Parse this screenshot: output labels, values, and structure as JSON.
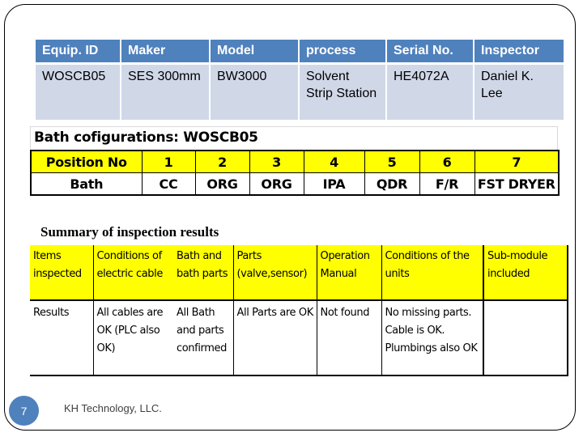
{
  "equipment": {
    "headers": [
      "Equip. ID",
      "Maker",
      "Model",
      "process",
      "Serial No.",
      "Inspector"
    ],
    "values": [
      "WOSCB05",
      "SES 300mm",
      "BW3000",
      "Solvent Strip Station",
      "HE4072A",
      "Daniel K. Lee"
    ]
  },
  "bath_config": {
    "title": "Bath cofigurations: WOSCB05",
    "position_label": "Position No",
    "positions": [
      "1",
      "2",
      "3",
      "4",
      "5",
      "6",
      "7"
    ],
    "bath_label": "Bath",
    "baths": [
      "CC",
      "ORG",
      "ORG",
      "IPA",
      "QDR",
      "F/R",
      "FST DRYER"
    ]
  },
  "summary": {
    "title": "Summary of inspection results",
    "header_row": [
      "Items inspected",
      "Conditions of electric cable",
      "Bath and bath parts",
      "Parts (valve,sensor)",
      "Operation Manual",
      "Conditions of the units",
      "Sub-module included"
    ],
    "result_row": [
      "Results",
      "All cables are OK (PLC also OK)",
      "All Bath and parts confirmed",
      "All Parts are OK",
      "Not found",
      "No missing parts. Cable is OK. Plumbings also OK",
      ""
    ]
  },
  "footer": {
    "page_number": "7",
    "company": "KH Technology, LLC."
  },
  "colors": {
    "header_blue": "#4f81bd",
    "cell_blue": "#d0d8e8",
    "highlight_yellow": "#ffff00"
  }
}
